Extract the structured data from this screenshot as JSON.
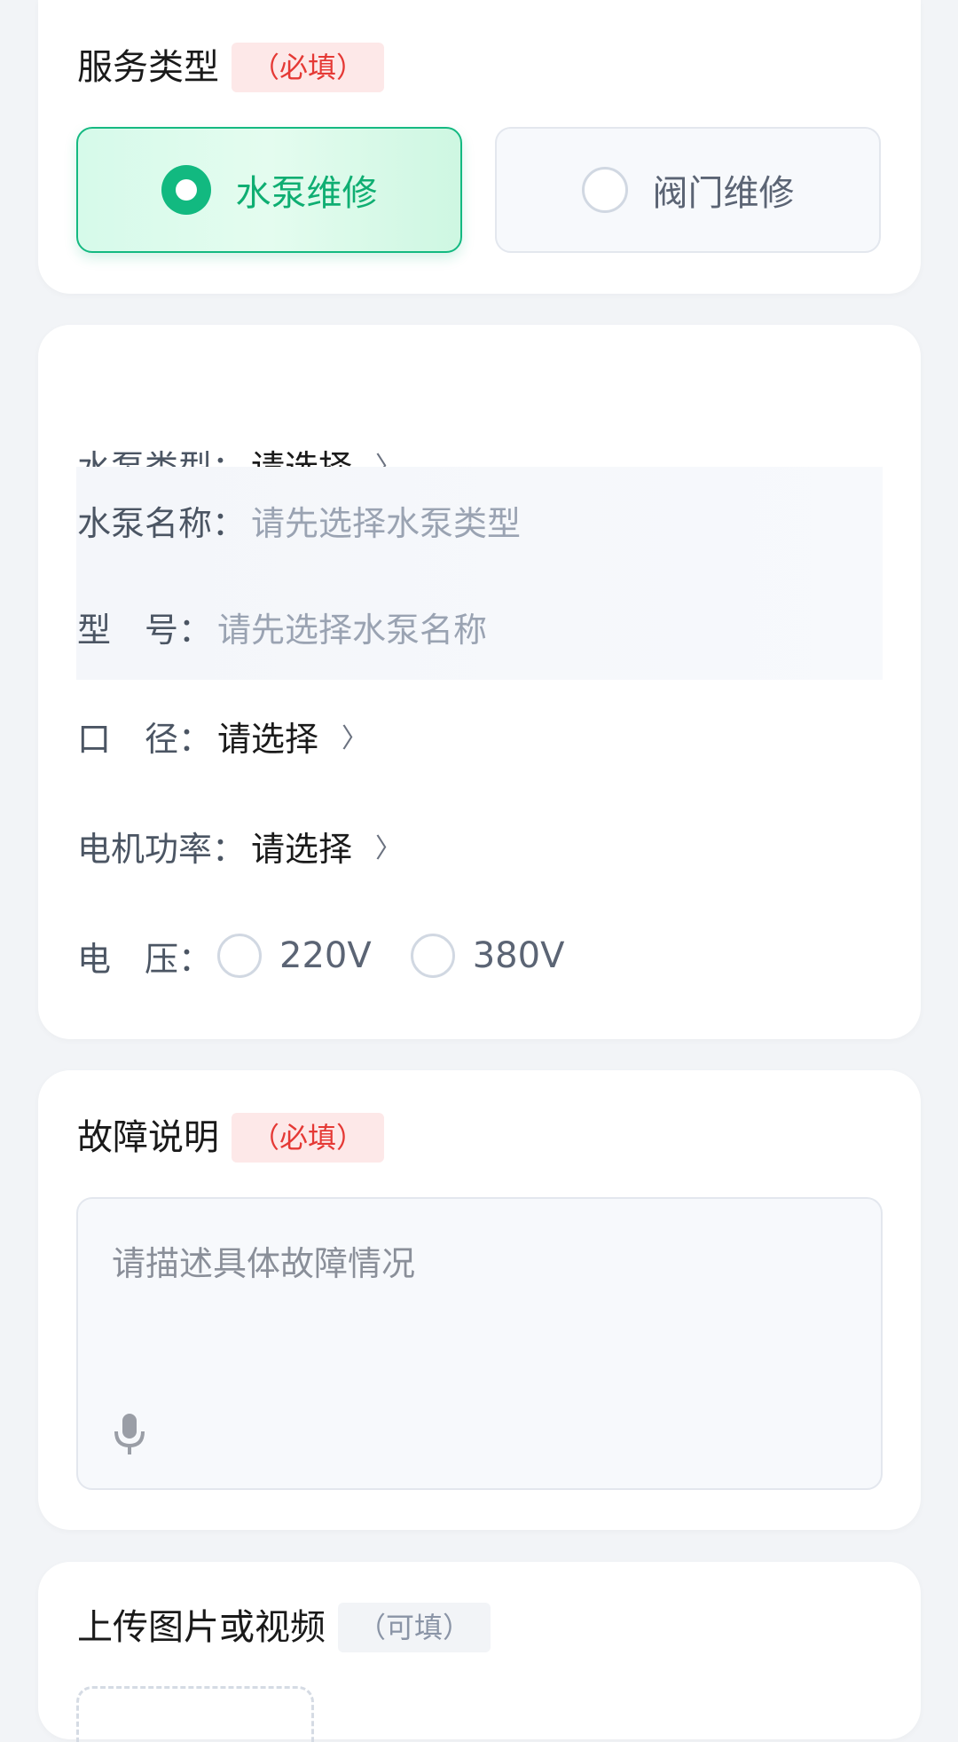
{
  "service_type": {
    "title": "服务类型",
    "required_tag": "（必填）",
    "options": [
      {
        "label": "水泵维修",
        "selected": true
      },
      {
        "label": "阀门维修",
        "selected": false
      }
    ]
  },
  "pump_form": {
    "fields": [
      {
        "label": "水泵类型：",
        "value": "请选择",
        "chevron": "〉"
      },
      {
        "label": "水泵名称：",
        "placeholder": "请先选择水泵类型"
      },
      {
        "label": "型　号：",
        "placeholder": "请先选择水泵名称"
      },
      {
        "label": "口　径：",
        "value": "请选择",
        "chevron": "〉"
      },
      {
        "label": "电机功率：",
        "value": "请选择",
        "chevron": "〉"
      }
    ],
    "voltage": {
      "label": "电　压：",
      "options": [
        "220V",
        "380V"
      ]
    }
  },
  "fault": {
    "title": "故障说明",
    "required_tag": "（必填）",
    "placeholder": "请描述具体故障情况",
    "mic_icon": "microphone-icon"
  },
  "upload": {
    "title": "上传图片或视频",
    "optional_tag": "（可填）"
  },
  "colors": {
    "accent": "#12b980",
    "required": "#e53935",
    "background": "#f2f4f7"
  }
}
